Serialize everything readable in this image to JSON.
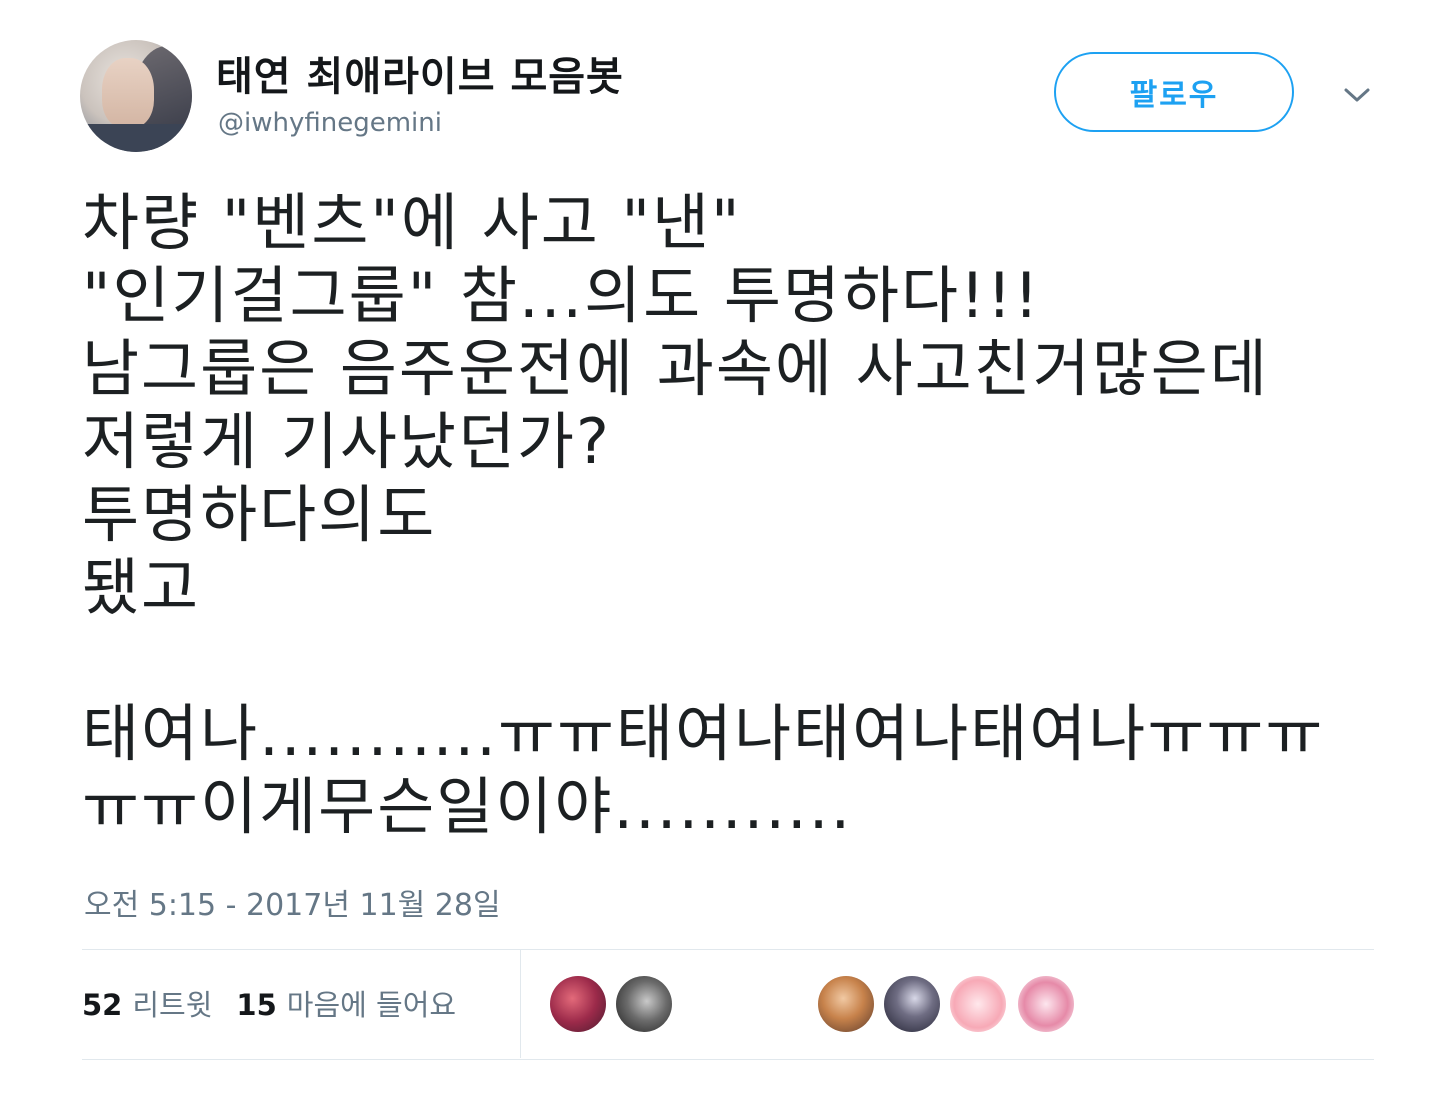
{
  "user": {
    "display_name": "태연 최애라이브 모음봇",
    "handle": "@iwhyfinegemini"
  },
  "follow_button": {
    "label": "팔로우"
  },
  "tweet": {
    "text": "차량 \"벤츠\"에 사고 \"낸\"\n\"인기걸그룹\"  참...의도 투명하다!!!\n남그룹은 음주운전에 과속에 사고친거많은데\n저렇게 기사났던가?\n투명하다의도\n됐고\n\n태여나...........ㅠㅠ태여나태여나태여나ㅠㅠㅠ\nㅠㅠ이게무슨일이야...........",
    "timestamp": "오전 5:15 - 2017년 11월 28일"
  },
  "stats": {
    "retweets_count": "52",
    "retweets_label": "리트윗",
    "likes_count": "15",
    "likes_label": "마음에 들어요"
  },
  "icons": {
    "caret": "chevron-down-icon"
  },
  "colors": {
    "accent": "#1da1f2",
    "secondary_text": "#657786",
    "primary_text": "#1c2022",
    "divider": "#e1e8ed"
  }
}
